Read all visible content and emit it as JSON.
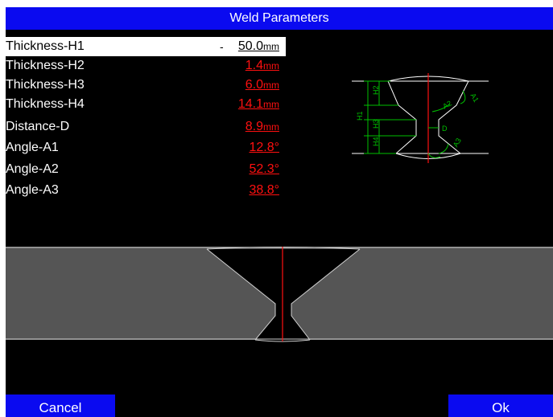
{
  "title": "Weld Parameters",
  "params": [
    {
      "label": "Thickness-H1",
      "value": "50.0",
      "unit": "mm"
    },
    {
      "label": "Thickness-H2",
      "value": "1.4",
      "unit": "mm"
    },
    {
      "label": "Thickness-H3",
      "value": "6.0",
      "unit": "mm"
    },
    {
      "label": "Thickness-H4",
      "value": "14.1",
      "unit": "mm"
    },
    {
      "label": "Distance-D",
      "value": "8.9",
      "unit": "mm"
    },
    {
      "label": "Angle-A1",
      "value": "12.8°",
      "unit": ""
    },
    {
      "label": "Angle-A2",
      "value": "52.3°",
      "unit": ""
    },
    {
      "label": "Angle-A3",
      "value": "38.8°",
      "unit": ""
    }
  ],
  "diagram": {
    "labels": {
      "h1": "H1",
      "h2": "H2",
      "h3": "H3",
      "h4": "H4",
      "d": "D",
      "a1": "A1",
      "a2": "A2",
      "a3": "A3"
    }
  },
  "buttons": {
    "cancel": "Cancel",
    "ok": "Ok"
  },
  "colors": {
    "accent": "#0a0af0",
    "value": "#ff1010",
    "dimension": "#00c000"
  }
}
